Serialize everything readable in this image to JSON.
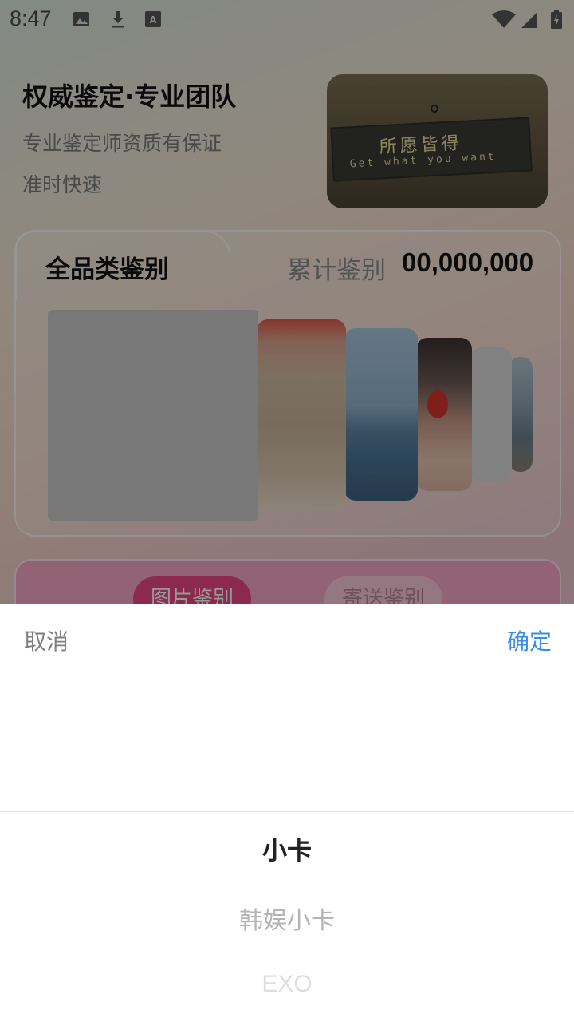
{
  "status_bar": {
    "time": "8:47",
    "icons": [
      "image-icon",
      "download-icon",
      "a-icon",
      "wifi-icon",
      "signal-icon",
      "battery-icon"
    ]
  },
  "hero": {
    "title": "权威鉴定·专业团队",
    "subtitle1": "专业鉴定师资质有保证",
    "subtitle2": "准时快速",
    "photo_sign_cn": "所愿皆得",
    "photo_sign_en": "Get what you want"
  },
  "category": {
    "title": "全品类鉴别",
    "cumulative_label": "累计鉴别",
    "cumulative_value": "00,000,000"
  },
  "modes": {
    "photo_label": "图片鉴别",
    "mail_label": "寄送鉴别"
  },
  "picker": {
    "cancel_label": "取消",
    "confirm_label": "确定",
    "options": [
      "小卡",
      "韩娱小卡",
      "EXO"
    ],
    "selected": "小卡"
  },
  "colors": {
    "confirm": "#3a8ee6",
    "mode_active": "#e8467f"
  }
}
